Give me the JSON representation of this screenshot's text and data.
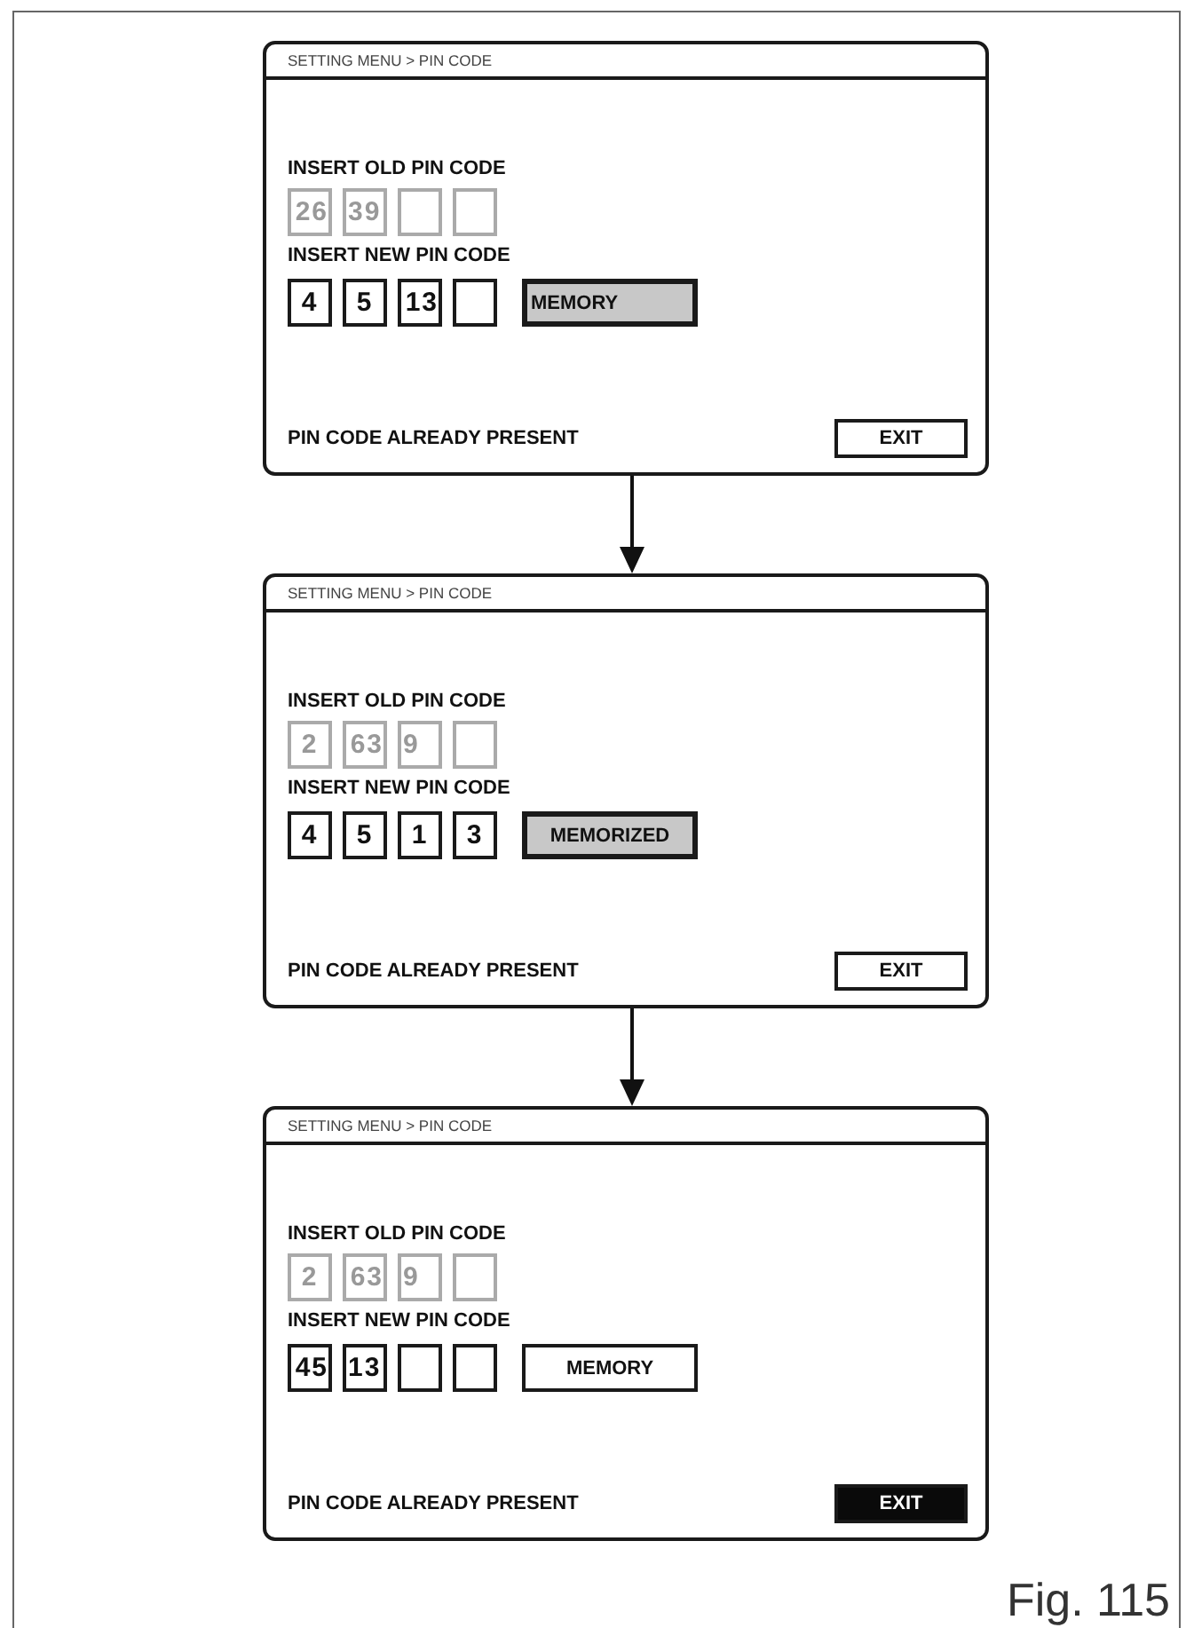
{
  "panels": [
    {
      "breadcrumb": "SETTING MENU > PIN CODE",
      "old_pin": {
        "label": "INSERT OLD PIN CODE",
        "disabled": true,
        "boxes": [
          {
            "kind": "overflow",
            "digit": "26"
          },
          {
            "kind": "carry",
            "digit": "39"
          },
          {
            "kind": "blank"
          },
          {
            "kind": "blank"
          }
        ]
      },
      "new_pin": {
        "label": "INSERT NEW PIN CODE",
        "disabled": false,
        "boxes": [
          {
            "kind": "digit",
            "digit": "4"
          },
          {
            "kind": "digit",
            "digit": "5"
          },
          {
            "kind": "overflow",
            "digit": "13"
          },
          {
            "kind": "blank"
          }
        ]
      },
      "memory_button": {
        "label": "MEMORY",
        "selected": true,
        "label_offset": true
      },
      "status": "PIN CODE ALREADY PRESENT",
      "exit_button": {
        "label": "EXIT",
        "selected": false
      }
    },
    {
      "breadcrumb": "SETTING MENU > PIN CODE",
      "old_pin": {
        "label": "INSERT OLD PIN CODE",
        "disabled": true,
        "boxes": [
          {
            "kind": "digit",
            "digit": "2"
          },
          {
            "kind": "overflow",
            "digit": "63"
          },
          {
            "kind": "carry",
            "digit": "9"
          },
          {
            "kind": "blank"
          }
        ]
      },
      "new_pin": {
        "label": "INSERT NEW PIN CODE",
        "disabled": false,
        "boxes": [
          {
            "kind": "digit",
            "digit": "4"
          },
          {
            "kind": "digit",
            "digit": "5"
          },
          {
            "kind": "digit",
            "digit": "1"
          },
          {
            "kind": "digit",
            "digit": "3"
          }
        ]
      },
      "memory_button": {
        "label": "MEMORIZED",
        "selected": true,
        "label_offset": false
      },
      "status": "PIN CODE ALREADY PRESENT",
      "exit_button": {
        "label": "EXIT",
        "selected": false
      }
    },
    {
      "breadcrumb": "SETTING MENU > PIN CODE",
      "old_pin": {
        "label": "INSERT OLD PIN CODE",
        "disabled": true,
        "boxes": [
          {
            "kind": "digit",
            "digit": "2"
          },
          {
            "kind": "overflow",
            "digit": "63"
          },
          {
            "kind": "carry",
            "digit": "9"
          },
          {
            "kind": "blank"
          }
        ]
      },
      "new_pin": {
        "label": "INSERT NEW PIN CODE",
        "disabled": false,
        "boxes": [
          {
            "kind": "overflow",
            "digit": "45"
          },
          {
            "kind": "carry",
            "digit": "13"
          },
          {
            "kind": "blank"
          },
          {
            "kind": "blank"
          }
        ]
      },
      "memory_button": {
        "label": "MEMORY",
        "selected": false,
        "label_offset": false
      },
      "status": "PIN CODE ALREADY PRESENT",
      "exit_button": {
        "label": "EXIT",
        "selected": true
      }
    }
  ],
  "caption": "Fig. 115"
}
